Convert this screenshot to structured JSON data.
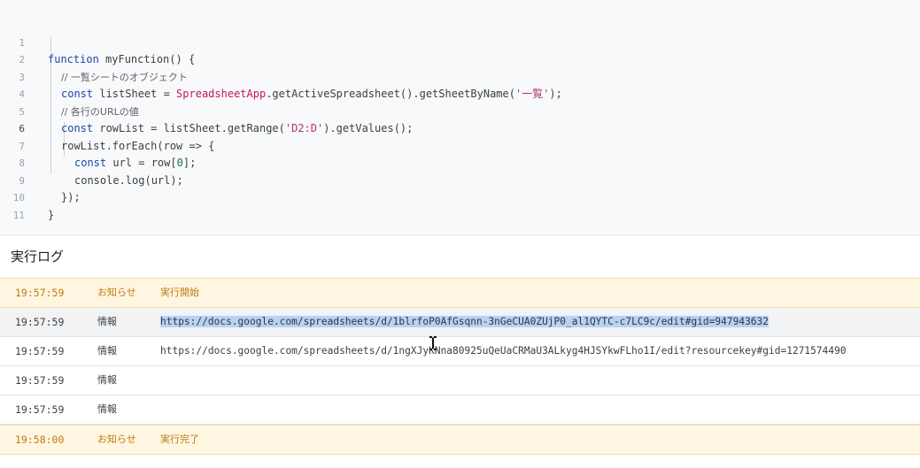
{
  "editor": {
    "lines": [
      {
        "num": "1"
      },
      {
        "num": "2"
      },
      {
        "num": "3"
      },
      {
        "num": "4"
      },
      {
        "num": "5"
      },
      {
        "num": "6"
      },
      {
        "num": "7"
      },
      {
        "num": "8"
      },
      {
        "num": "9"
      },
      {
        "num": "10"
      },
      {
        "num": "11"
      }
    ],
    "code": {
      "l1_kw": "function",
      "l1_rest": " myFunction() {",
      "l2_cmt": "// 一覧シートのオブジェクト",
      "l3_kw": "const",
      "l3_a": " listSheet = ",
      "l3_cls": "SpreadsheetApp",
      "l3_b": ".getActiveSpreadsheet().getSheetByName(",
      "l3_str": "'一覧'",
      "l3_c": ");",
      "l4_cmt": "// 各行のURLの値",
      "l5_kw": "const",
      "l5_a": " rowList = listSheet.getRange(",
      "l5_str": "'D2:D'",
      "l5_b": ").getValues();",
      "l6": "rowList.forEach(row => {",
      "l7_kw": "const",
      "l7_a": " url = row[",
      "l7_num": "0",
      "l7_b": "];",
      "l8": "console.log(url);",
      "l9": "});",
      "l10": "}"
    }
  },
  "log": {
    "title": "実行ログ",
    "rows": [
      {
        "time": "19:57:59",
        "severity": "お知らせ",
        "message": "実行開始"
      },
      {
        "time": "19:57:59",
        "severity": "情報",
        "message": "https://docs.google.com/spreadsheets/d/1blrfoP0AfGsqnn-3nGeCUA0ZUjP0_al1QYTC-c7LC9c/edit#gid=947943632"
      },
      {
        "time": "19:57:59",
        "severity": "情報",
        "message": "https://docs.google.com/spreadsheets/d/1ngXJyKNna80925uQeUaCRMaU3ALkyg4HJSYkwFLho1I/edit?resourcekey#gid=1271574490"
      },
      {
        "time": "19:57:59",
        "severity": "情報",
        "message": ""
      },
      {
        "time": "19:57:59",
        "severity": "情報",
        "message": ""
      },
      {
        "time": "19:58:00",
        "severity": "お知らせ",
        "message": "実行完了"
      }
    ]
  },
  "colors": {
    "notice_bg": "#fef6e0",
    "notice_text": "#c07a10",
    "selection": "#b8d2f2",
    "keyword": "#1a47a8"
  },
  "icons": {
    "cursor": "text-cursor-icon"
  }
}
